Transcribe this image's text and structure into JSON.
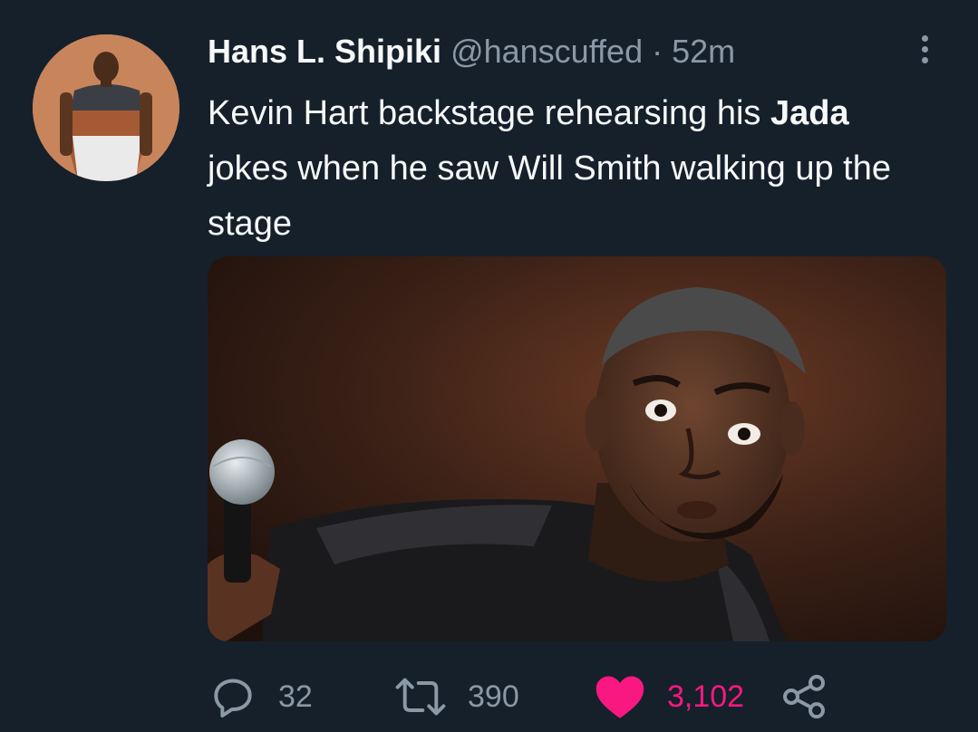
{
  "tweet": {
    "author_name": "Hans L. Shipiki",
    "handle": "@hanscuffed",
    "separator": "·",
    "time": "52m",
    "text_before": "Kevin Hart backstage rehearsing his",
    "text_bold": "Jada",
    "text_after": "jokes when he saw Will Smith walking up the stage"
  },
  "actions": {
    "replies": "32",
    "retweets": "390",
    "likes": "3,102"
  },
  "colors": {
    "background": "#15202b",
    "secondary_text": "#8b98a5",
    "like": "#f91880"
  },
  "icons": [
    "more-options-icon",
    "reply-icon",
    "retweet-icon",
    "like-heart-icon",
    "share-icon"
  ]
}
